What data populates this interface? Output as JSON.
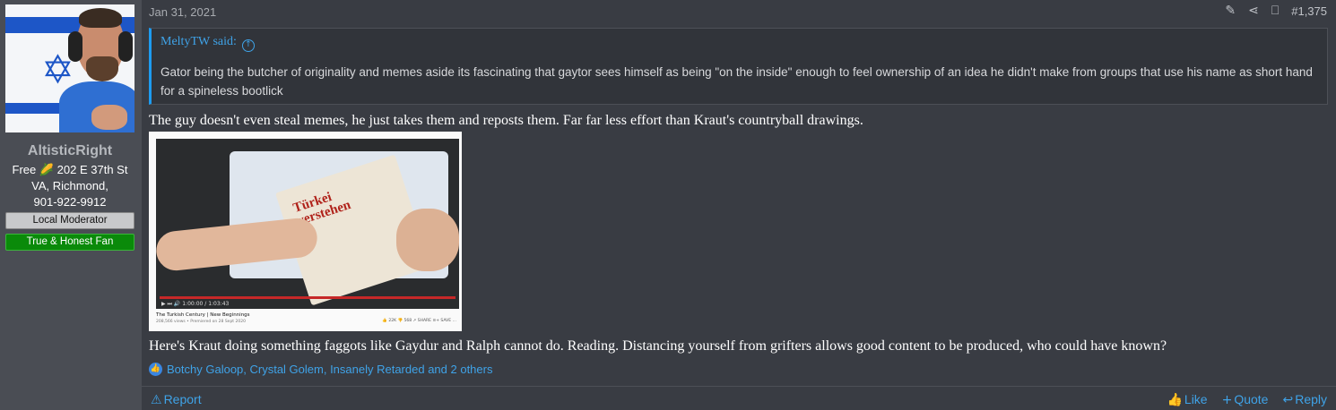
{
  "user": {
    "username": "AltisticRight",
    "info_line1": "Free 🌽 202 E 37th St",
    "info_line2": "VA, Richmond,",
    "info_line3": "901-922-9912",
    "badge_mod": "Local Moderator",
    "badge_fan": "True & Honest Fan"
  },
  "post": {
    "date": "Jan 31, 2021",
    "number": "#1,375",
    "quote_author": "MeltyTW said:",
    "quote_text": "Gator being the butcher of originality and memes aside its fascinating that gaytor sees himself as being \"on the inside\" enough to feel ownership of an idea he didn't make from groups that use his name as short hand for a spineless bootlick",
    "text1": "The guy doesn't even steal memes, he just takes them and reposts them. Far far less effort than Kraut's countryball drawings.",
    "text2": "Here's Kraut doing something faggots like Gaydur and Ralph cannot do. Reading. Distancing yourself from grifters allows good content to be produced, who could have known?"
  },
  "embed": {
    "book_title_line1": "Türkei",
    "book_title_line2": "verstehen",
    "video_title": "The Turkish Century | New Beginnings",
    "video_meta": "208,566 views • Premiered on 28 Sept 2020",
    "video_time": "1:00:00 / 1:03:43",
    "video_buttons": "👍 22K   👎 568   ↗ SHARE   ≡+ SAVE   …"
  },
  "reactions": {
    "text": "Botchy Galoop, Crystal Golem, Insanely Retarded and 2 others"
  },
  "footer": {
    "report": "Report",
    "like": "Like",
    "quote": "Quote",
    "reply": "Reply"
  },
  "icons": {
    "edit": "pencil-icon",
    "share": "share-icon",
    "bookmark": "bookmark-icon"
  }
}
